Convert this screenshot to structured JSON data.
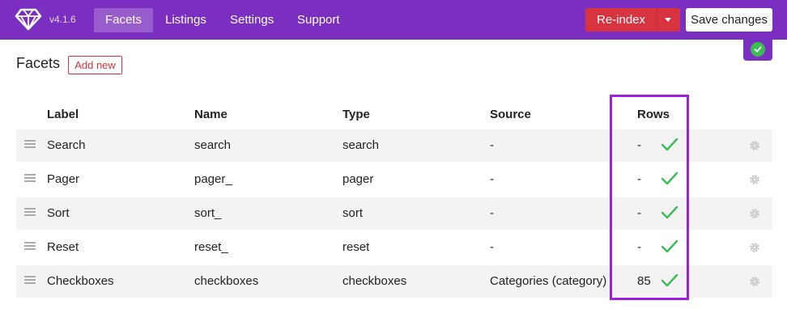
{
  "header": {
    "version": "v4.1.6",
    "nav": [
      {
        "label": "Facets",
        "active": true
      },
      {
        "label": "Listings",
        "active": false
      },
      {
        "label": "Settings",
        "active": false
      },
      {
        "label": "Support",
        "active": false
      }
    ],
    "reindex_label": "Re-index",
    "save_label": "Save changes",
    "colors": {
      "bar": "#7b2fc1",
      "reindex": "#d9333f",
      "ok": "#3dbb55"
    }
  },
  "page": {
    "title": "Facets",
    "add_new_label": "Add new"
  },
  "table": {
    "columns": [
      "Label",
      "Name",
      "Type",
      "Source",
      "Rows"
    ],
    "rows": [
      {
        "label": "Search",
        "name": "search",
        "type": "search",
        "source": "-",
        "rows": "-"
      },
      {
        "label": "Pager",
        "name": "pager_",
        "type": "pager",
        "source": "-",
        "rows": "-"
      },
      {
        "label": "Sort",
        "name": "sort_",
        "type": "sort",
        "source": "-",
        "rows": "-"
      },
      {
        "label": "Reset",
        "name": "reset_",
        "type": "reset",
        "source": "-",
        "rows": "-"
      },
      {
        "label": "Checkboxes",
        "name": "checkboxes",
        "type": "checkboxes",
        "source": "Categories (category)",
        "rows": "85"
      }
    ]
  }
}
